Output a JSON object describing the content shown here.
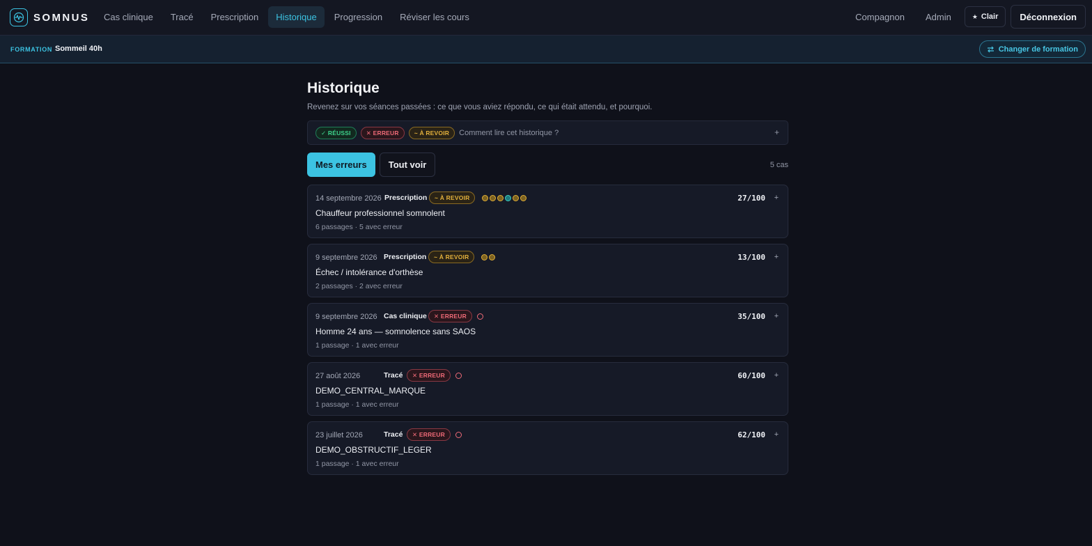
{
  "app": {
    "name": "SOMNUS"
  },
  "nav": {
    "links": [
      {
        "label": "Cas clinique",
        "active": false
      },
      {
        "label": "Tracé",
        "active": false
      },
      {
        "label": "Prescription",
        "active": false
      },
      {
        "label": "Historique",
        "active": true
      },
      {
        "label": "Progression",
        "active": false
      },
      {
        "label": "Réviser les cours",
        "active": false
      }
    ],
    "right": {
      "companion": "Compagnon",
      "admin": "Admin",
      "theme": "Clair",
      "logout": "Déconnexion"
    }
  },
  "formation": {
    "label": "FORMATION",
    "name": "Sommeil 40h",
    "change": "Changer de formation"
  },
  "page": {
    "title": "Historique",
    "subtitle": "Revenez sur vos séances passées : ce que vous aviez répondu, ce qui était attendu, et pourquoi."
  },
  "legend": {
    "ok": "✓ RÉUSSI",
    "err": "✕ ERREUR",
    "rev": "~ À REVOIR",
    "help": "Comment lire cet historique ?",
    "toggle": "+"
  },
  "filters": {
    "mine": "Mes erreurs",
    "all": "Tout voir",
    "count": "5 cas"
  },
  "colors": {
    "accent": "#3cc3e2",
    "ok": "#3ed38c",
    "err": "#ee6a77",
    "rev": "#e3b13c"
  },
  "cards": [
    {
      "date": "14 septembre 2026",
      "type": "Prescription",
      "status": "rev",
      "status_label": "~ À REVOIR",
      "dots": [
        "rev",
        "rev",
        "rev",
        "ok",
        "rev",
        "rev"
      ],
      "score": "27/100",
      "title": "Chauffeur professionnel somnolent",
      "meta": "6 passages · 5 avec erreur",
      "toggle": "+"
    },
    {
      "date": "9 septembre 2026",
      "type": "Prescription",
      "status": "rev",
      "status_label": "~ À REVOIR",
      "dots": [
        "rev",
        "rev"
      ],
      "score": "13/100",
      "title": "Échec / intolérance d'orthèse",
      "meta": "2 passages · 2 avec erreur",
      "toggle": "+"
    },
    {
      "date": "9 septembre 2026",
      "type": "Cas clinique",
      "status": "err",
      "status_label": "✕ ERREUR",
      "dots": [
        "err"
      ],
      "score": "35/100",
      "title": "Homme 24 ans — somnolence sans SAOS",
      "meta": "1 passage · 1 avec erreur",
      "toggle": "+"
    },
    {
      "date": "27 août 2026",
      "type": "Tracé",
      "status": "err",
      "status_label": "✕ ERREUR",
      "dots": [
        "err"
      ],
      "score": "60/100",
      "title": "DEMO_CENTRAL_MARQUE",
      "meta": "1 passage · 1 avec erreur",
      "toggle": "+"
    },
    {
      "date": "23 juillet 2026",
      "type": "Tracé",
      "status": "err",
      "status_label": "✕ ERREUR",
      "dots": [
        "err"
      ],
      "score": "62/100",
      "title": "DEMO_OBSTRUCTIF_LEGER",
      "meta": "1 passage · 1 avec erreur",
      "toggle": "+"
    }
  ]
}
